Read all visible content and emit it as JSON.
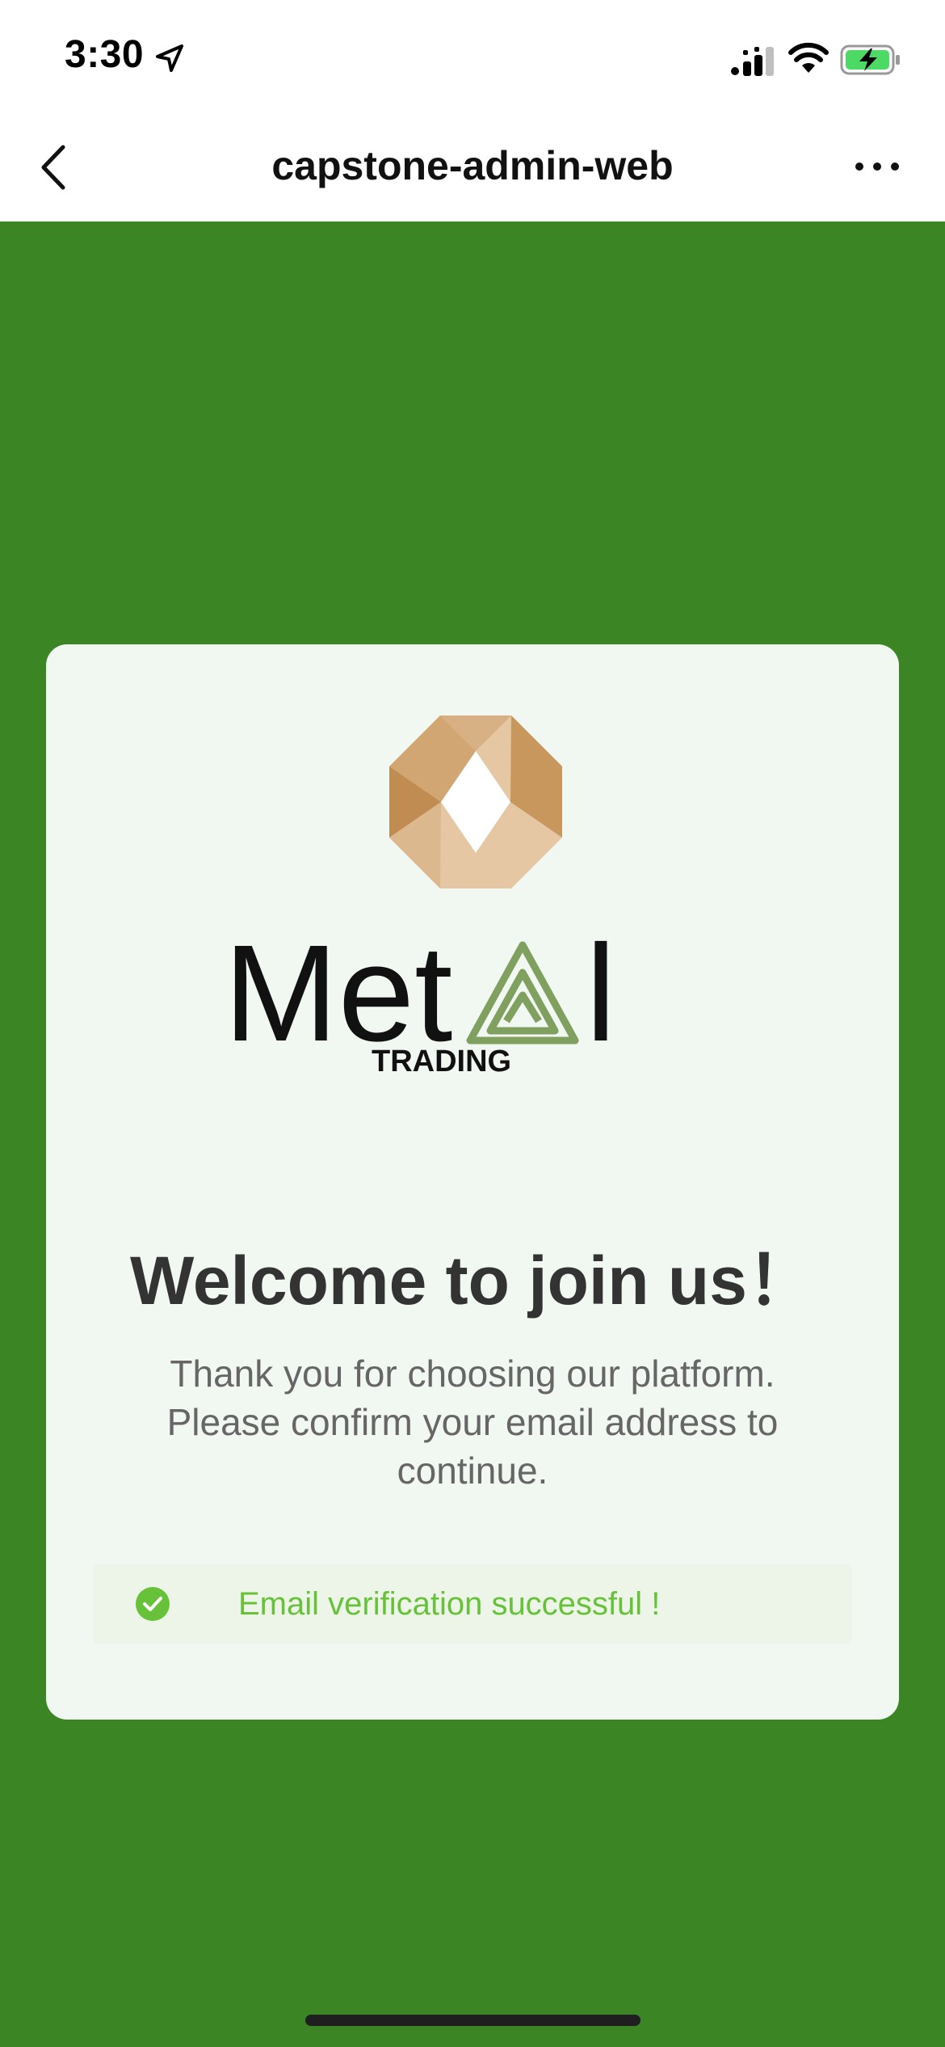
{
  "status_bar": {
    "time": "3:30",
    "icons": [
      "location-arrow-icon",
      "cellular-signal-icon",
      "wifi-icon",
      "battery-charging-icon"
    ]
  },
  "nav": {
    "title": "capstone-admin-web",
    "back_icon": "chevron-left-icon",
    "more_icon": "more-icon"
  },
  "colors": {
    "page_background": "#3b8524",
    "card_background": "#f1f7f1",
    "title_text": "#333333",
    "body_text": "#666666",
    "success": "#67c23a",
    "logo_gold": "#c8975d",
    "logo_green": "#7fa05f"
  },
  "card": {
    "logo": {
      "wordmark": "Metal",
      "tagline": "TRADING"
    },
    "title": "Welcome to join us！",
    "body": "Thank you for choosing our platform. Please confirm your email address to continue.",
    "alert": {
      "icon": "check-circle-icon",
      "message": "Email verification successful !"
    }
  }
}
